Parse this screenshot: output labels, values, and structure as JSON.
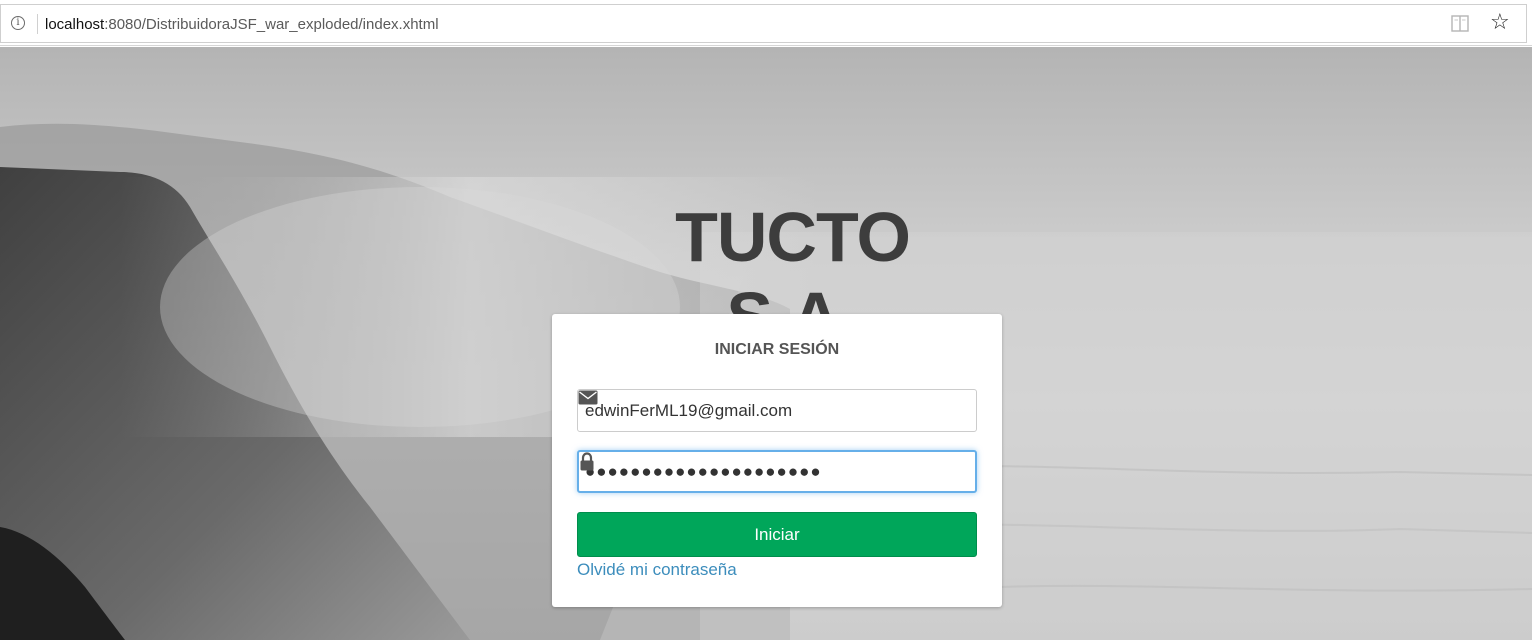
{
  "browser": {
    "url_host": "localhost",
    "url_rest": ":8080/DistribuidoraJSF_war_exploded/index.xhtml",
    "icons": [
      "info-icon",
      "reading-view-icon",
      "favorite-star-icon"
    ]
  },
  "brand": {
    "title": "TUCTO S.A."
  },
  "login": {
    "heading": "INICIAR SESIÓN",
    "email_value": "edwinFerML19@gmail.com",
    "password_mask": "●●●●●●●●●●●●●●●●●●●●●",
    "submit_label": "Iniciar",
    "forgot_label": "Olvidé mi contraseña",
    "email_icon": "envelope-icon",
    "password_icon": "lock-icon"
  },
  "colors": {
    "button_green": "#00a65a",
    "link_blue": "#3c8dbc",
    "focus_blue": "#66afe9",
    "brand_text": "#3d3d3d"
  }
}
